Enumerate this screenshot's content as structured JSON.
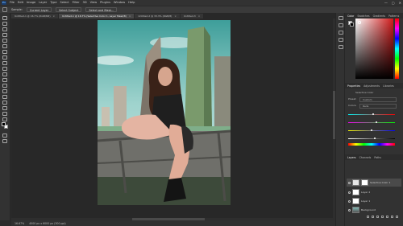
{
  "menu": {
    "items": [
      "File",
      "Edit",
      "Image",
      "Layer",
      "Type",
      "Select",
      "Filter",
      "3D",
      "View",
      "Plugins",
      "Window",
      "Help"
    ],
    "window_controls": [
      "—",
      "▢",
      "✕"
    ]
  },
  "options": {
    "items": [
      "Sample:",
      "Current Layer",
      "Select Subject",
      "Select and Mask..."
    ]
  },
  "tabs": [
    {
      "label": "Untitled-1 @ 16.7% (RGB/8#)",
      "active": false
    },
    {
      "label": "Untitled-1 @ 16.7% (Selective Color 1, Layer Mask/8)",
      "active": true
    },
    {
      "label": "Untitled-2 @ 33.3% (RGB/8)",
      "active": false
    },
    {
      "label": "Untitled-3",
      "active": false
    }
  ],
  "status": {
    "zoom": "16.67%",
    "doc_info": "4000 px x 6000 px (300 ppi)"
  },
  "panels": {
    "color_tabs": [
      "Color",
      "Swatches",
      "Gradients",
      "Patterns"
    ],
    "properties_tabs": [
      "Properties",
      "Adjustments",
      "Libraries"
    ],
    "properties_title": "Selective Color",
    "preset_label": "Preset:",
    "preset_value": "Custom",
    "colors_label": "Colors:",
    "colors_value": "Reds",
    "layers_tabs": [
      "Layers",
      "Channels",
      "Paths"
    ],
    "layers": [
      {
        "name": "Selective Color 1",
        "selected": true,
        "kind": "adjustment"
      },
      {
        "name": "Layer 2",
        "selected": false,
        "kind": "white"
      },
      {
        "name": "Layer 1",
        "selected": false,
        "kind": "white"
      },
      {
        "name": "Background",
        "selected": false,
        "kind": "photo"
      }
    ]
  },
  "colors": {
    "accent_hue_top": "#ff0000",
    "picker_base": "#d11a1a",
    "app_dark": "#282828",
    "panel": "#323232"
  }
}
